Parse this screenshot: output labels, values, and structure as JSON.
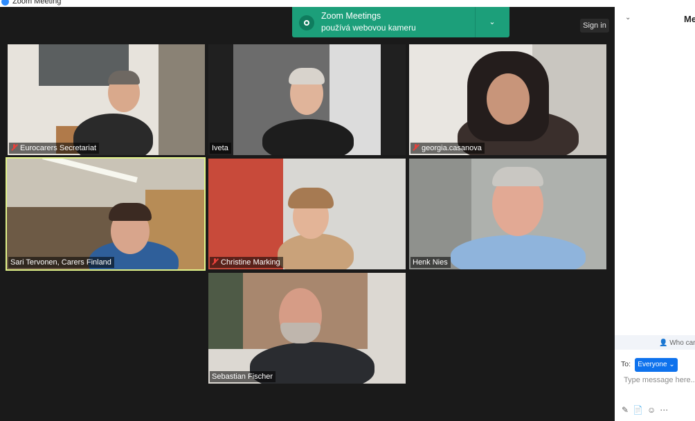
{
  "window": {
    "title": "Zoom Meeting"
  },
  "notification": {
    "app": "Zoom Meetings",
    "message": "používá webovou kameru"
  },
  "header": {
    "sign_in_label": "Sign in"
  },
  "participants": [
    {
      "name": "Eurocarers Secretariat",
      "muted": true
    },
    {
      "name": "Iveta",
      "muted": false
    },
    {
      "name": "georgia.casanova",
      "muted": true
    },
    {
      "name": "Sari Tervonen, Carers Finland",
      "muted": false,
      "speaking": true
    },
    {
      "name": "Christine Marking",
      "muted": true
    },
    {
      "name": "Henk Nies",
      "muted": false
    },
    {
      "name": "Sebastian Fischer",
      "muted": false
    }
  ],
  "chat": {
    "title": "Me",
    "who_can_see": "Who car",
    "to_label": "To:",
    "recipient": "Everyone",
    "placeholder": "Type message here..."
  },
  "colors": {
    "notification": "#1c9f7a",
    "active_speaker_border": "#e2f38a",
    "recipient_button": "#0e72ed",
    "muted_mic": "#e8403a"
  }
}
